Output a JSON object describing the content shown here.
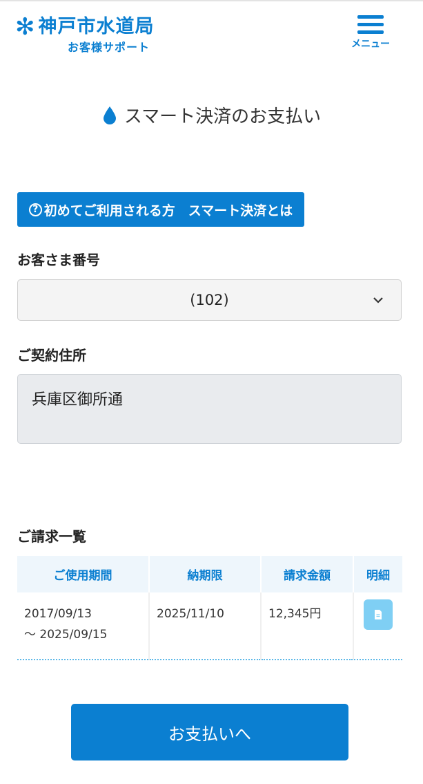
{
  "header": {
    "logo_main": "神戸市水道局",
    "logo_sub": "お客様サポート",
    "menu_label": "メニュー"
  },
  "page": {
    "title": "スマート決済のお支払い",
    "intro_button": "初めてご利用される方　スマート決済とは"
  },
  "customer": {
    "label": "お客さま番号",
    "selected": "(102)"
  },
  "address": {
    "label": "ご契約住所",
    "value": "兵庫区御所通"
  },
  "billing": {
    "label": "ご請求一覧",
    "columns": [
      "ご使用期間",
      "納期限",
      "請求金額",
      "明細"
    ],
    "rows": [
      {
        "period_start": "2017/09/13",
        "period_end": "〜 2025/09/15",
        "due": "2025/11/10",
        "amount": "12,345円"
      }
    ]
  },
  "actions": {
    "pay_label": "お支払いへ"
  },
  "colors": {
    "brand": "#0b7fd1",
    "detail_button": "#7fcff4",
    "table_header_bg": "#eef6fc",
    "address_bg": "#e9ebee"
  },
  "icons": [
    "asterisk-logo-icon",
    "menu-icon",
    "water-drop-icon",
    "question-icon",
    "chevron-down-icon",
    "document-icon"
  ]
}
